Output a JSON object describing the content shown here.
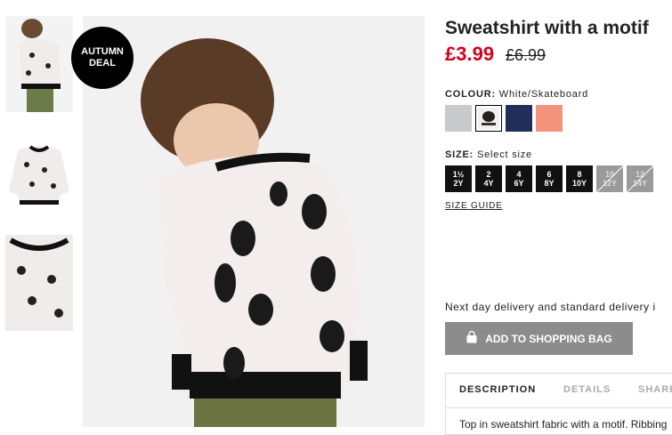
{
  "badge": {
    "line1": "AUTUMN",
    "line2": "DEAL"
  },
  "product": {
    "title": "Sweatshirt with a motif",
    "price": "£3.99",
    "old_price": "£6.99"
  },
  "colour": {
    "label": "COLOUR:",
    "value": "White/Skateboard",
    "swatches": [
      {
        "name": "grey-melange",
        "color": "#c8cacb"
      },
      {
        "name": "white-skateboard",
        "color": "#f2f0ef",
        "selected": true
      },
      {
        "name": "dark-blue",
        "color": "#1f2f5a"
      },
      {
        "name": "coral",
        "color": "#f4937d"
      }
    ]
  },
  "size": {
    "label": "SIZE:",
    "value": "Select size",
    "options": [
      {
        "top": "1½",
        "bottom": "2Y",
        "available": true
      },
      {
        "top": "2",
        "bottom": "4Y",
        "available": true
      },
      {
        "top": "4",
        "bottom": "6Y",
        "available": true
      },
      {
        "top": "6",
        "bottom": "8Y",
        "available": true
      },
      {
        "top": "8",
        "bottom": "10Y",
        "available": true
      },
      {
        "top": "10",
        "bottom": "12Y",
        "available": false
      },
      {
        "top": "12",
        "bottom": "14Y",
        "available": false
      }
    ],
    "guide": "SIZE GUIDE"
  },
  "delivery": "Next day delivery and standard delivery i",
  "add_to_bag": {
    "label": "ADD TO SHOPPING BAG",
    "icon": "shopping-bag-icon"
  },
  "tabs": {
    "items": [
      "DESCRIPTION",
      "DETAILS",
      "SHARE"
    ],
    "active": 0,
    "description": "Top in sweatshirt fabric with a motif. Ribbing"
  },
  "colors": {
    "price_red": "#d6001c",
    "button_grey": "#8c8c8c"
  }
}
